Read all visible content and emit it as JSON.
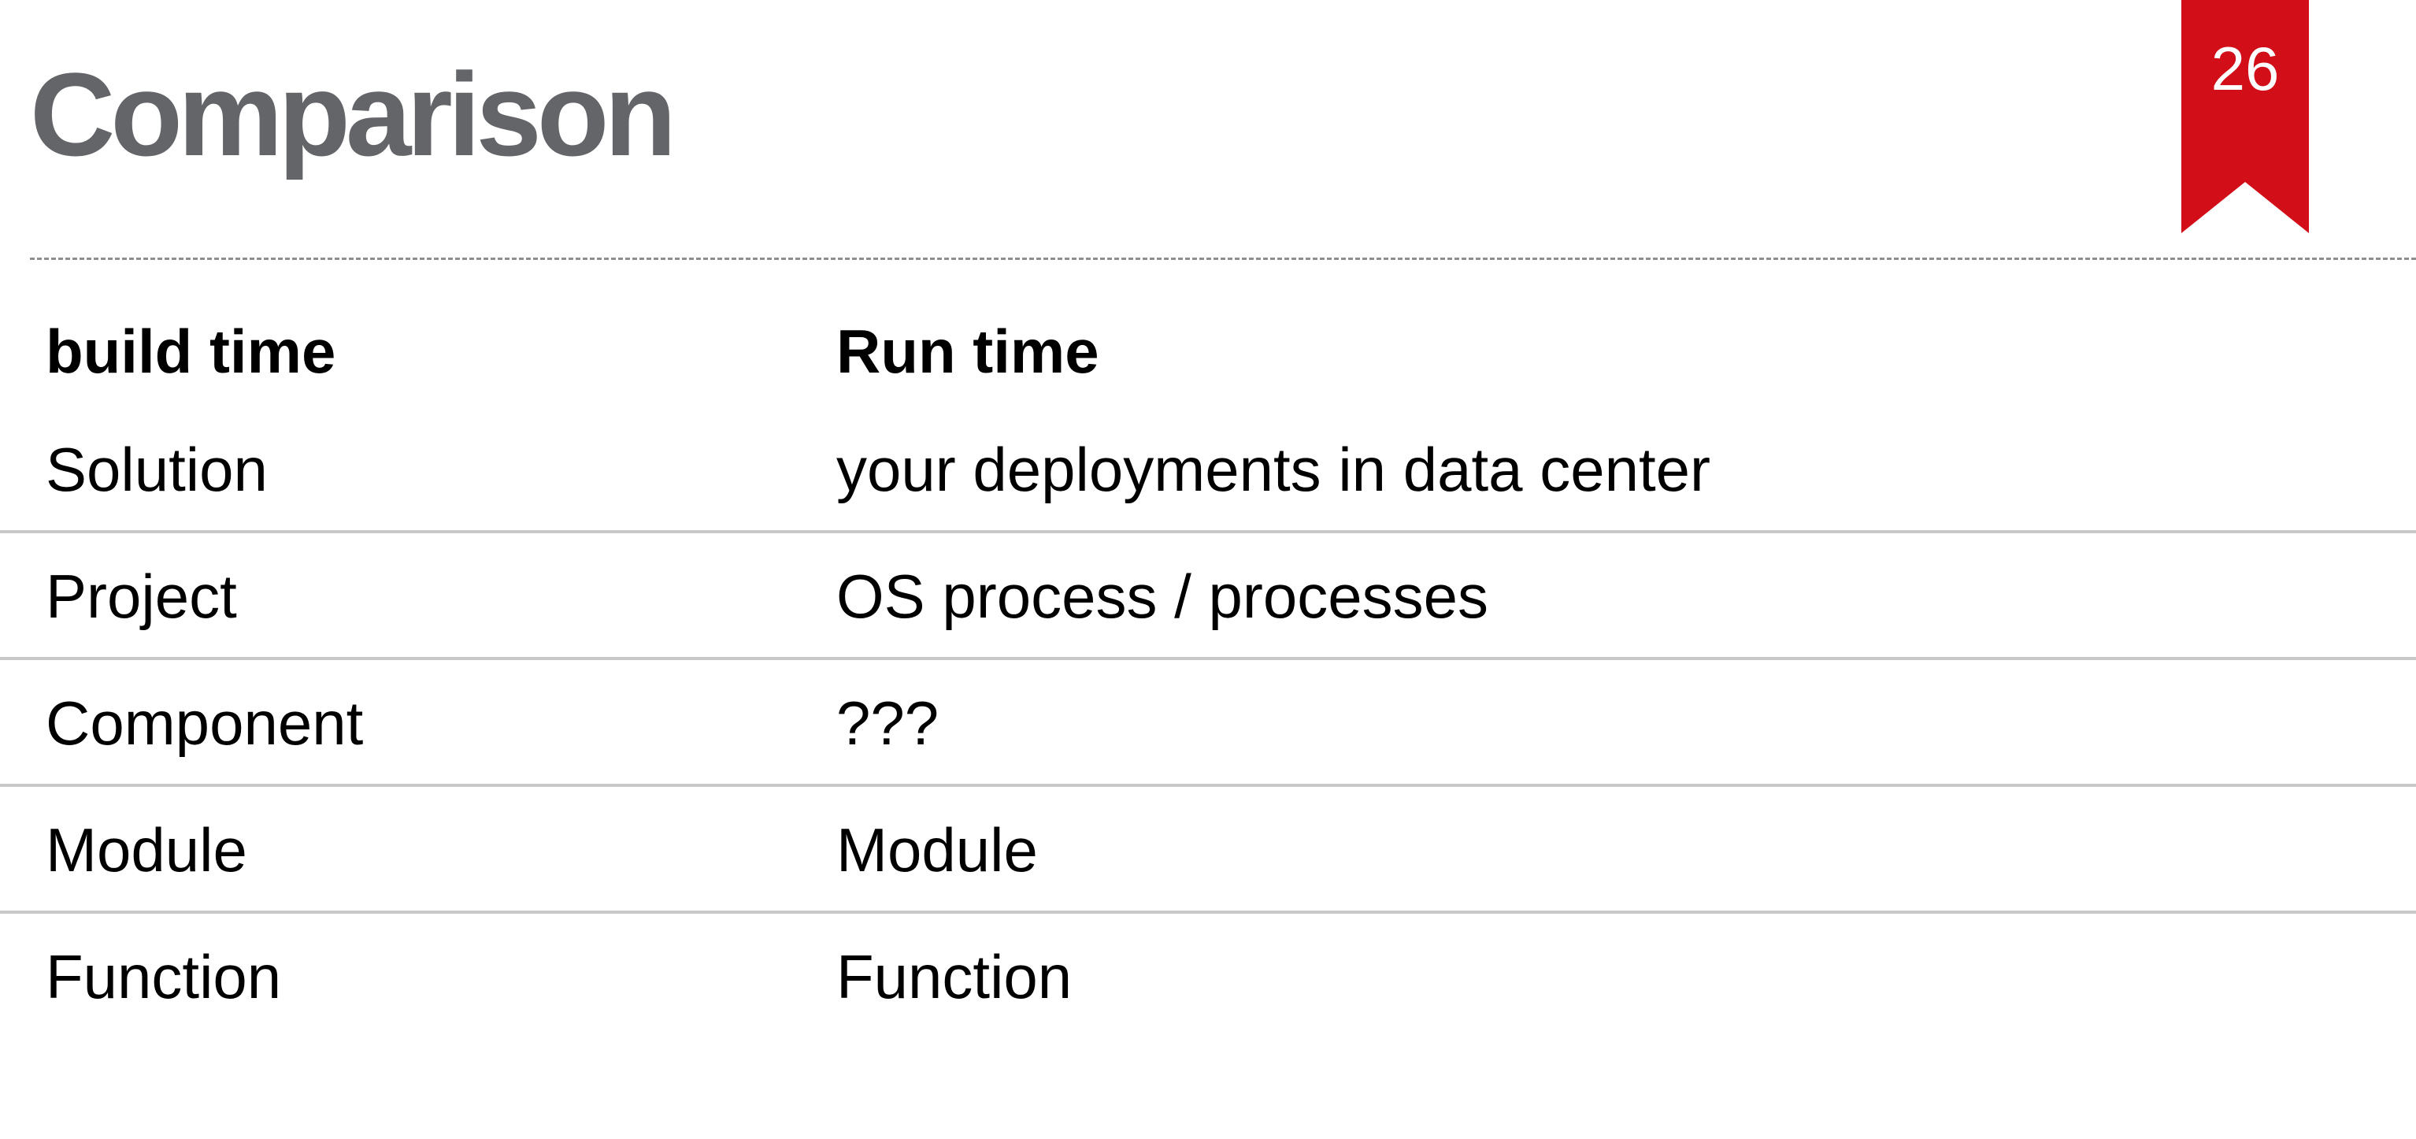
{
  "slide": {
    "title": "Comparison",
    "page_number": "26",
    "accent_color": "#d20f19",
    "title_color": "#636569"
  },
  "table": {
    "headers": [
      "build time",
      "Run time"
    ],
    "rows": [
      [
        "Solution",
        "your deployments in data center"
      ],
      [
        "Project",
        "OS process / processes"
      ],
      [
        "Component",
        "???"
      ],
      [
        "Module",
        "Module"
      ],
      [
        "Function",
        "Function"
      ]
    ]
  }
}
